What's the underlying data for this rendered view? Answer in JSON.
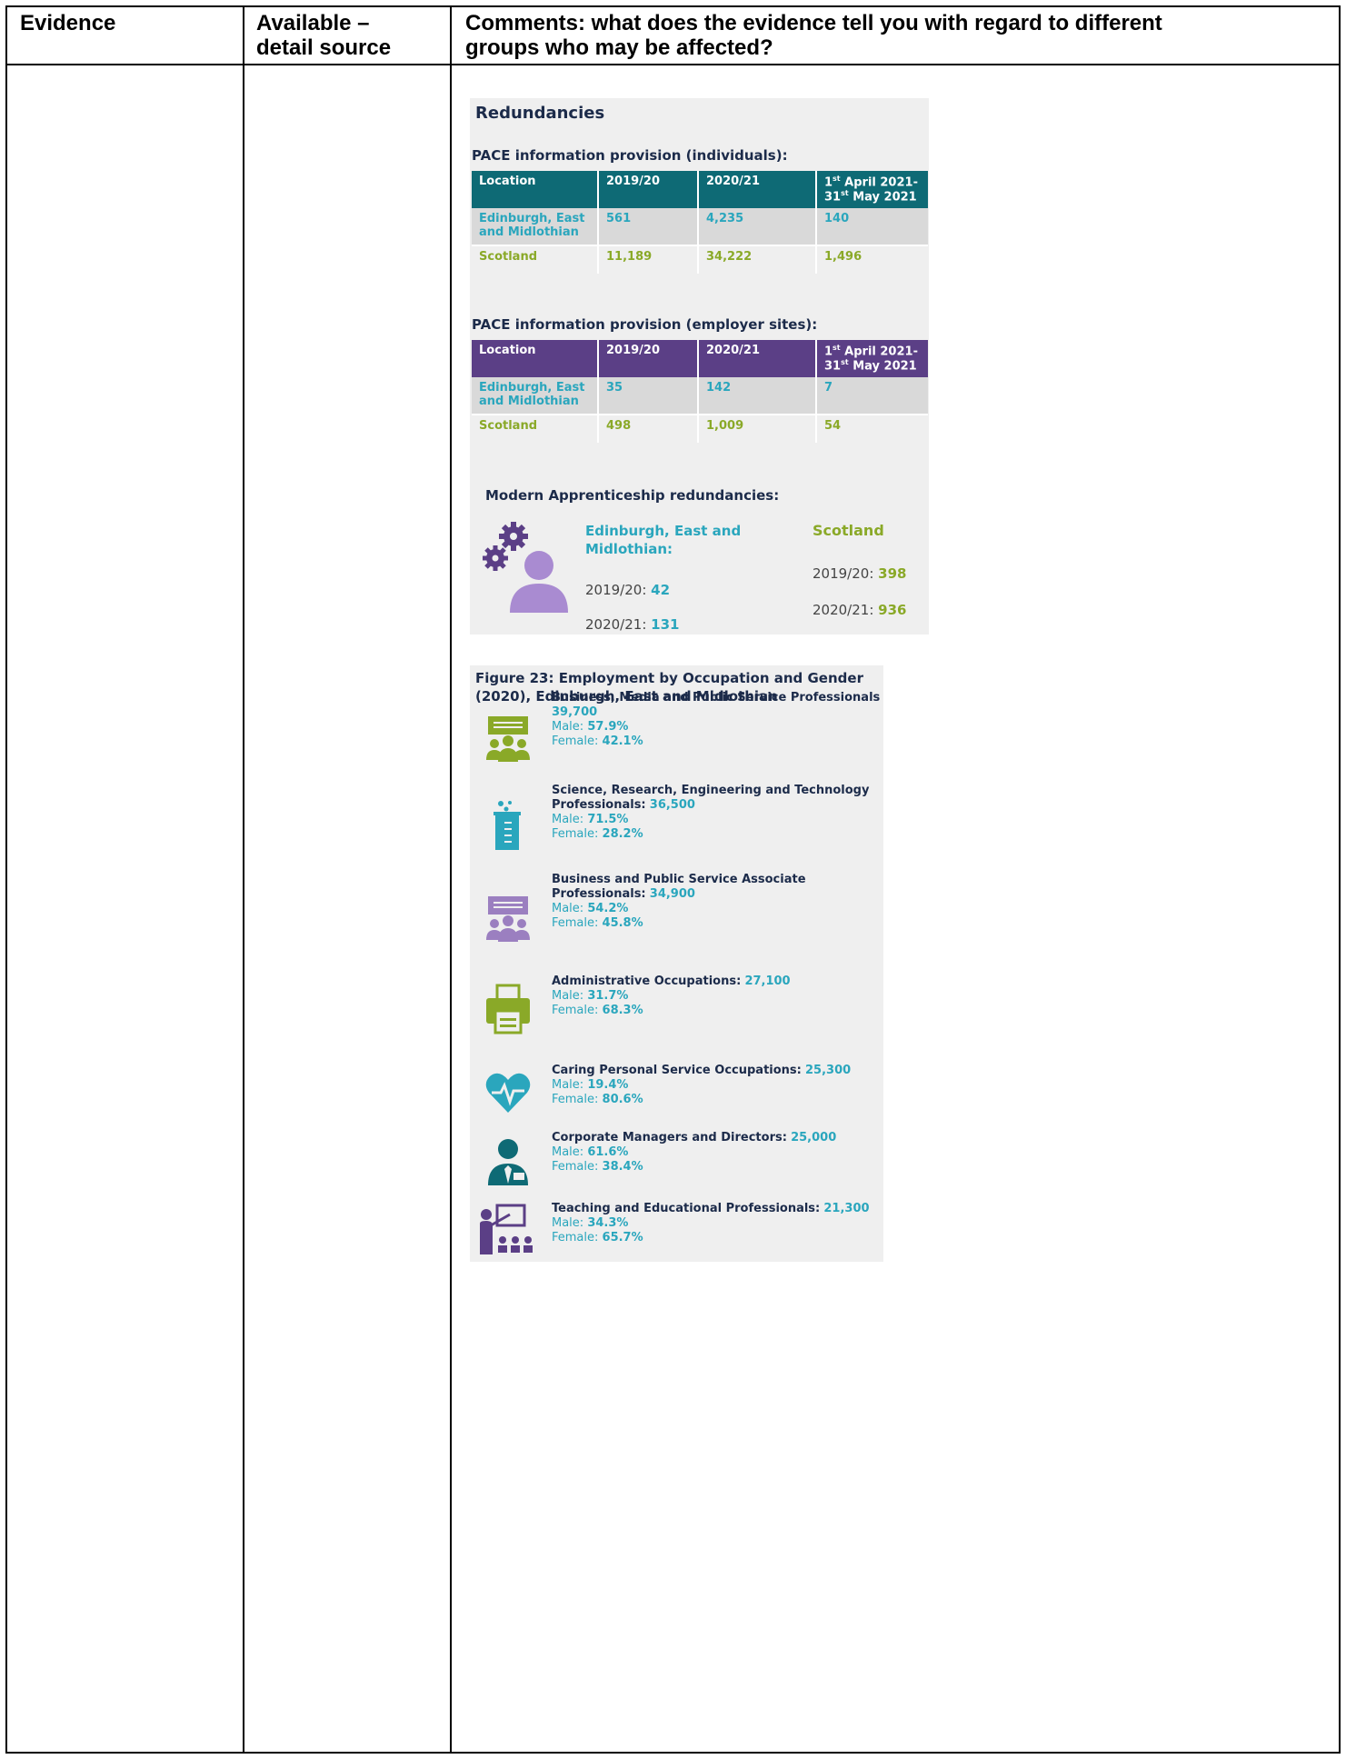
{
  "headers": {
    "evidence": "Evidence",
    "available_line1": "Available –",
    "available_line2": "detail source",
    "comments_line1": "Comments: what does the evidence tell you with regard to different",
    "comments_line2": "groups who may be affected?"
  },
  "redundancies": {
    "title": "Redundancies",
    "individuals": {
      "title": "PACE information provision (individuals):",
      "columns": [
        "Location",
        "2019/20",
        "2020/21",
        "1",
        "st",
        " April 2021-",
        "31",
        "st",
        " May 2021"
      ],
      "rows": [
        [
          "Edinburgh, East and Midlothian",
          "561",
          "4,235",
          "140"
        ],
        [
          "Scotland",
          "11,189",
          "34,222",
          "1,496"
        ]
      ]
    },
    "employer_sites": {
      "title": "PACE information provision (employer sites):",
      "columns": [
        "Location",
        "2019/20",
        "2020/21",
        "1",
        "st",
        " April 2021-",
        "31",
        "st",
        " May 2021"
      ],
      "rows": [
        [
          "Edinburgh, East and Midlothian",
          "35",
          "142",
          "7"
        ],
        [
          "Scotland",
          "498",
          "1,009",
          "54"
        ]
      ]
    },
    "modern_apprenticeship": {
      "title": "Modern Apprenticeship redundancies:",
      "eem_label": "Edinburgh, East and Midlothian:",
      "eem_2019_label": "2019/20:",
      "eem_2019_value": "42",
      "eem_2020_label": "2020/21:",
      "eem_2020_value": "131",
      "scotland_label": "Scotland",
      "sco_2019_label": "2019/20:",
      "sco_2019_value": "398",
      "sco_2020_label": "2020/21:",
      "sco_2020_value": "936"
    }
  },
  "figure23": {
    "title": "Figure 23: Employment by Occupation and Gender (2020), Edinburgh, East and Midlothian",
    "male_label": "Male:",
    "female_label": "Female:",
    "occupations": [
      {
        "name": "Business, Media and Public Service Professionals",
        "count": "39,700",
        "male": "57.9%",
        "female": "42.1%",
        "icon": "presentation-group-icon",
        "color": "#8aa928"
      },
      {
        "name": "Science, Research, Engineering and Technology Professionals:",
        "count": "36,500",
        "male": "71.5%",
        "female": "28.2%",
        "icon": "beaker-icon",
        "color": "#2aa6bd"
      },
      {
        "name": "Business and Public Service Associate Professionals:",
        "count": "34,900",
        "male": "54.2%",
        "female": "45.8%",
        "icon": "presentation-group-icon",
        "color": "#9b7fc0"
      },
      {
        "name": "Administrative Occupations:",
        "count": "27,100",
        "male": "31.7%",
        "female": "68.3%",
        "icon": "printer-icon",
        "color": "#8aa928"
      },
      {
        "name": "Caring Personal Service Occupations:",
        "count": "25,300",
        "male": "19.4%",
        "female": "80.6%",
        "icon": "heart-pulse-icon",
        "color": "#2aa6bd"
      },
      {
        "name": "Corporate Managers and Directors:",
        "count": "25,000",
        "male": "61.6%",
        "female": "38.4%",
        "icon": "manager-icon",
        "color": "#0e6a75"
      },
      {
        "name": "Teaching and Educational Professionals:",
        "count": "21,300",
        "male": "34.3%",
        "female": "65.7%",
        "icon": "teacher-icon",
        "color": "#5b3f86"
      }
    ]
  },
  "colors": {
    "teal_header": "#0e6a75",
    "purple_header": "#5b3f86",
    "teal_text": "#2aa6bd",
    "green_text": "#8aa928"
  }
}
